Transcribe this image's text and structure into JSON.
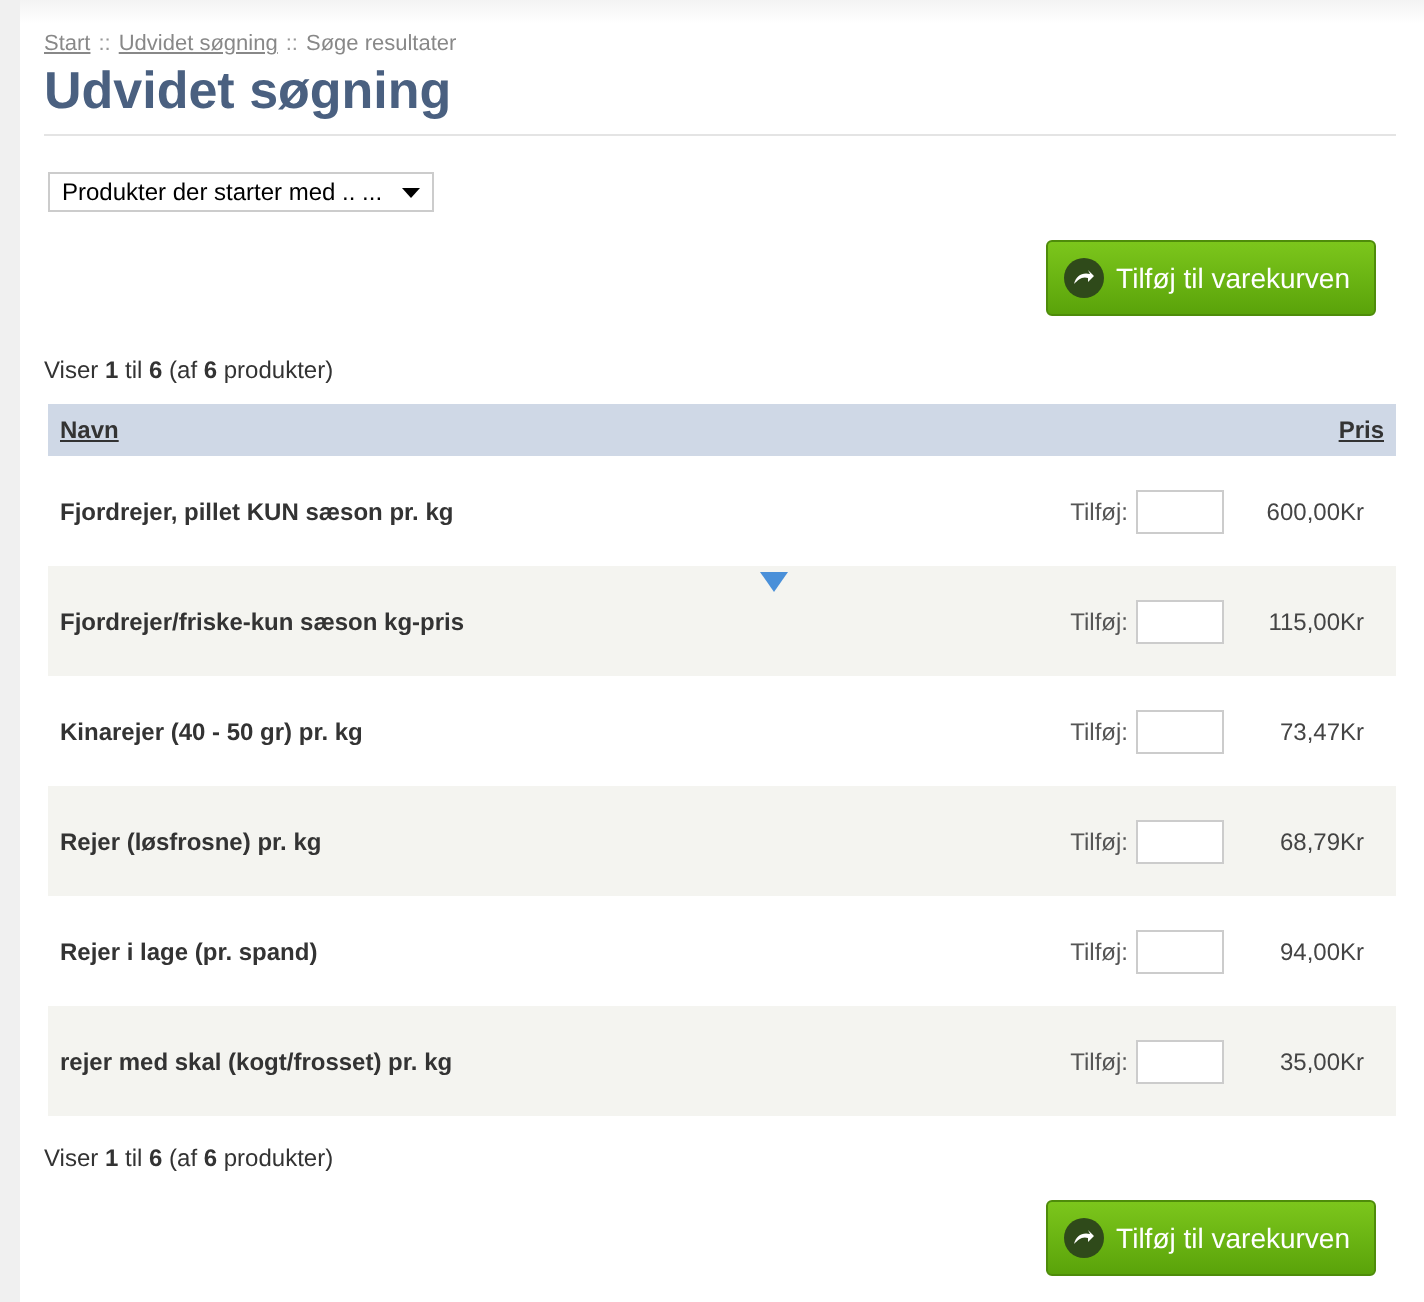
{
  "breadcrumb": [
    {
      "label": "Start",
      "link": true
    },
    {
      "label": "Udvidet søgning",
      "link": true
    },
    {
      "label": "Søge resultater",
      "link": false
    }
  ],
  "breadcrumb_separator": "::",
  "title": "Udvidet søgning",
  "filter": {
    "value": "Produkter der starter med .. ..."
  },
  "add_button_top": "Tilføj til varekurven",
  "count_top": "Viser **1** til **6** (af **6** produkter)",
  "table": {
    "columns": [
      "Navn",
      "Pris"
    ],
    "rows": [
      {
        "name": "Fjordrejer, pillet KUN sæson pr. kg",
        "add_label": "Tilføj:",
        "price": "600,00Kr"
      },
      {
        "name": "Fjordrejer/friske-kun sæson kg-pris",
        "add_label": "Tilføj:",
        "price": "115,00Kr"
      },
      {
        "name": "Kinarejer (40 - 50 gr) pr. kg",
        "add_label": "Tilføj:",
        "price": "73,47Kr"
      },
      {
        "name": "Rejer (løsfrosne) pr. kg",
        "add_label": "Tilføj:",
        "price": "68,79Kr"
      },
      {
        "name": "Rejer i lage (pr. spand)",
        "add_label": "Tilføj:",
        "price": "94,00Kr"
      },
      {
        "name": "rejer med skal (kogt/frosset) pr. kg",
        "add_label": "Tilføj:",
        "price": "35,00Kr"
      }
    ]
  },
  "count_bottom": "Viser **1** til **6** (af **6** produkter)",
  "add_button_bottom": "Tilføj til varekurven"
}
